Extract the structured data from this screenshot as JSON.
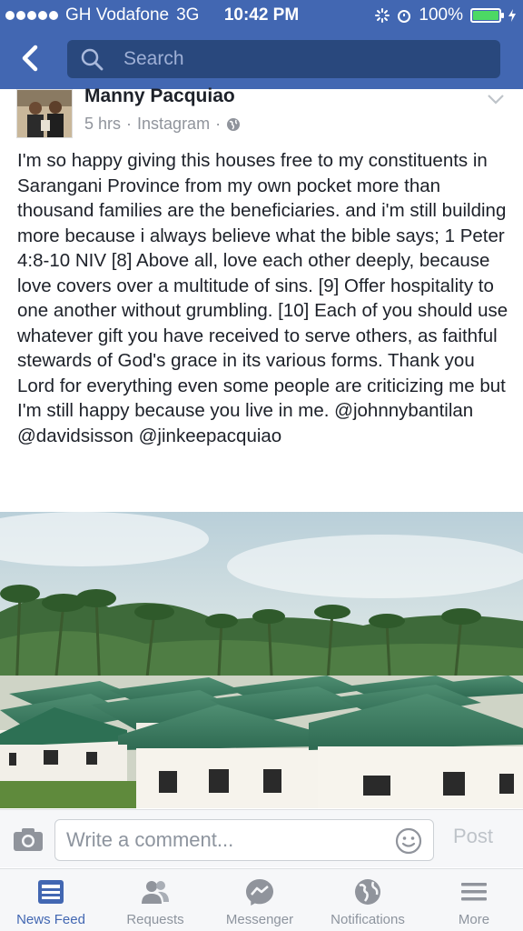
{
  "status_bar": {
    "carrier": "GH Vodafone",
    "network": "3G",
    "time": "10:42 PM",
    "battery": "100%",
    "signal_bars": 5,
    "battery_level": 1.0,
    "battery_color": "#4cd964"
  },
  "nav": {
    "back_icon": "chevron-left-icon",
    "search_placeholder": "Search"
  },
  "post": {
    "author": "Manny Pacquiao",
    "time": "5 hrs",
    "source": "Instagram",
    "privacy_icon": "globe-icon",
    "text": "I'm so happy giving this houses free to my constituents in Sarangani Province from my own pocket more than thousand families are the beneficiaries. and i'm still building more because i always believe what the bible says; 1 Peter 4:8-10 NIV [8] Above all, love each other deeply, because love covers over a multitude of sins. [9] Offer hospitality to one another without grumbling. [10] Each of you should use whatever gift you have received to serve others, as faithful stewards of God's grace in its various forms. Thank you Lord for everything even some people are criticizing me but I'm still happy because you live in me. @johnnybantilan @davidsisson @jinkeepacquiao"
  },
  "comment_bar": {
    "placeholder": "Write a comment...",
    "post_label": "Post"
  },
  "tabs": [
    {
      "label": "News Feed",
      "icon": "news-feed-icon",
      "active": true
    },
    {
      "label": "Requests",
      "icon": "friend-requests-icon",
      "active": false
    },
    {
      "label": "Messenger",
      "icon": "messenger-icon",
      "active": false
    },
    {
      "label": "Notifications",
      "icon": "globe-icon",
      "active": false
    },
    {
      "label": "More",
      "icon": "menu-icon",
      "active": false
    }
  ],
  "colors": {
    "brand": "#4267b2",
    "search_bg": "#29487d",
    "text": "#1d2129",
    "muted": "#90949c"
  }
}
